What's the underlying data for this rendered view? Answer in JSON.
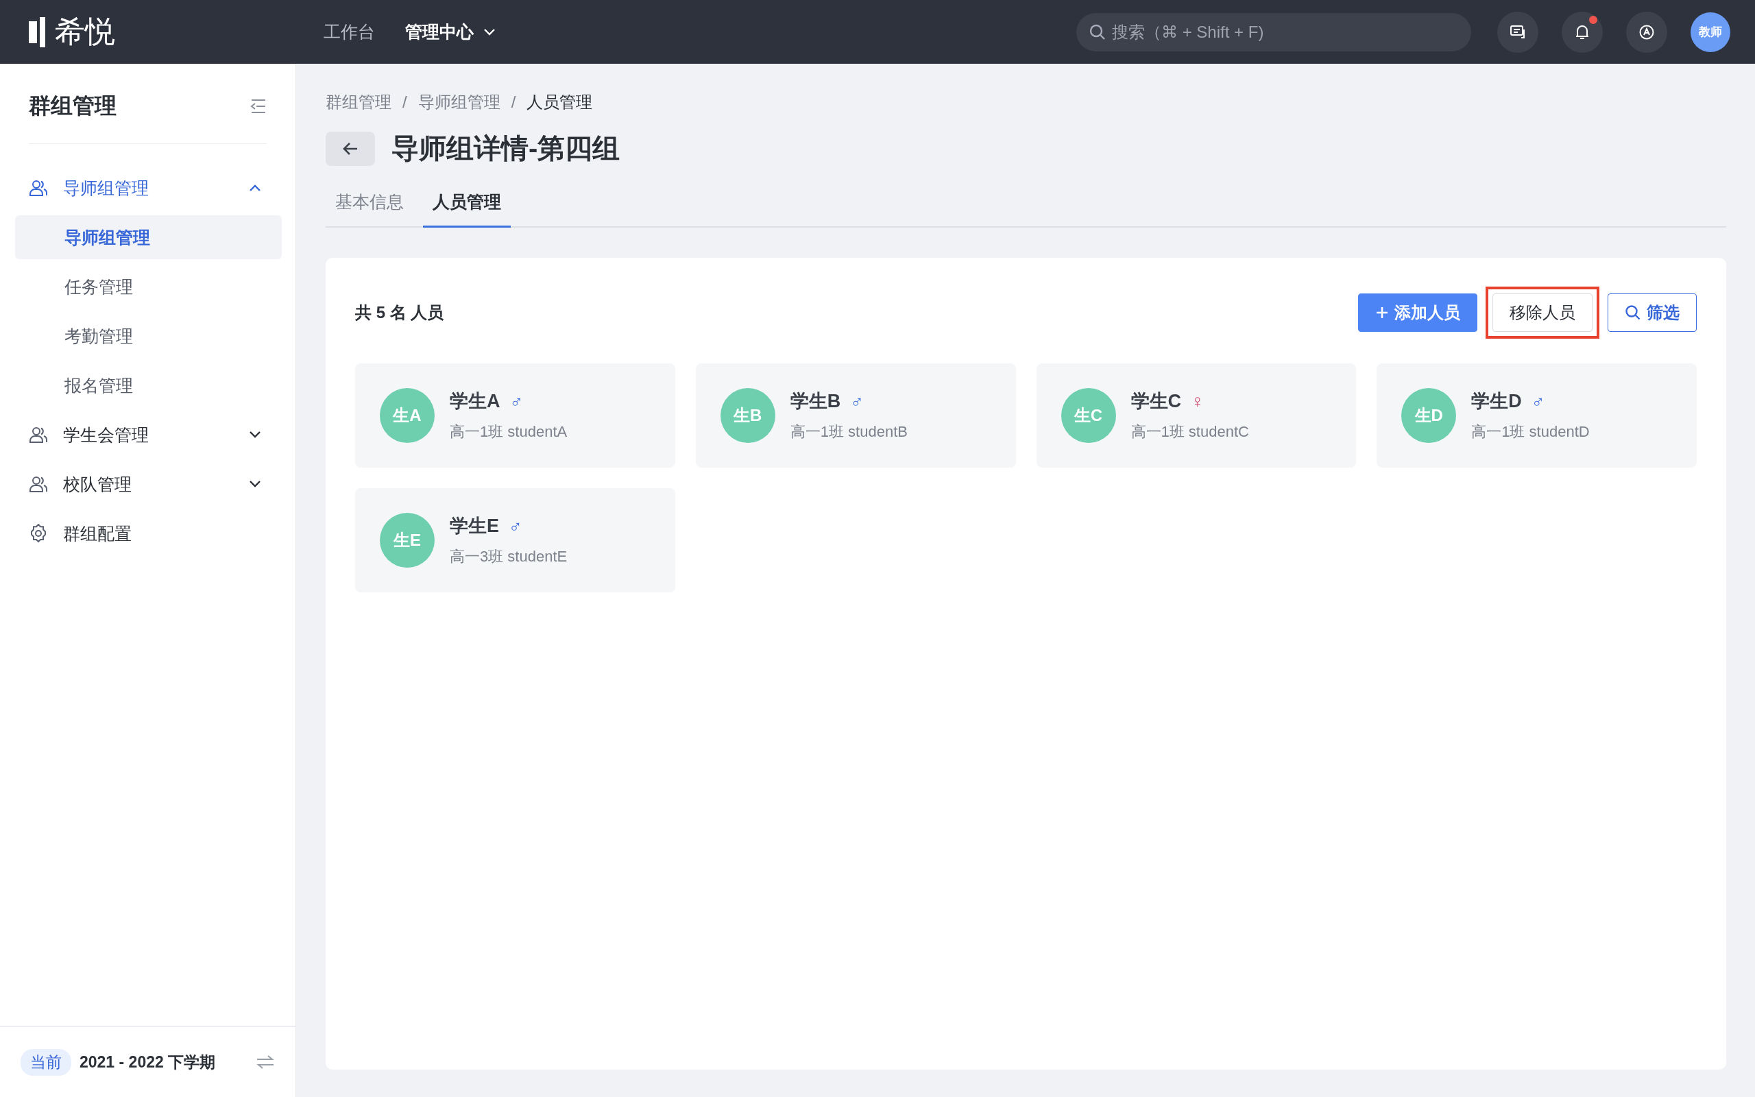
{
  "topbar": {
    "logo": "希悦",
    "nav": [
      {
        "label": "工作台",
        "selected": false,
        "dropdown": false
      },
      {
        "label": "管理中心",
        "selected": true,
        "dropdown": true
      }
    ],
    "search": {
      "placeholder": "搜索（⌘ + Shift + F)"
    },
    "icons": [
      {
        "kind": "chat",
        "badge": false
      },
      {
        "kind": "bell",
        "badge": true
      },
      {
        "kind": "switch",
        "badge": false
      }
    ],
    "avatar": "教师"
  },
  "sidebar": {
    "title": "群组管理",
    "items": [
      {
        "label": "导师组管理",
        "kind": "group",
        "selected": true,
        "expanded": true,
        "children": [
          {
            "label": "导师组管理",
            "selected": true
          },
          {
            "label": "任务管理",
            "selected": false
          },
          {
            "label": "考勤管理",
            "selected": false
          },
          {
            "label": "报名管理",
            "selected": false
          }
        ]
      },
      {
        "label": "学生会管理",
        "kind": "group",
        "selected": false,
        "expanded": false
      },
      {
        "label": "校队管理",
        "kind": "group",
        "selected": false,
        "expanded": false
      },
      {
        "label": "群组配置",
        "kind": "config",
        "selected": false
      }
    ],
    "footer": {
      "tag": "当前",
      "term": "2021 - 2022 下学期"
    }
  },
  "breadcrumb": [
    {
      "label": "群组管理"
    },
    {
      "separator": "/",
      "label": "导师组管理"
    },
    {
      "separator": "/",
      "label": "人员管理"
    }
  ],
  "page_title": "导师组详情-第四组",
  "tabs": [
    {
      "label": "基本信息",
      "selected": false
    },
    {
      "label": "人员管理",
      "selected": true
    }
  ],
  "panel": {
    "count": "共 5 名 人员",
    "buttons": [
      {
        "kind": "primary",
        "label": "添加人员",
        "highlighted": false
      },
      {
        "kind": "default",
        "label": "移除人员",
        "highlighted": true
      },
      {
        "kind": "outline",
        "label": "筛选",
        "highlighted": false
      }
    ],
    "members": [
      {
        "avatar": "生A",
        "name": "学生A",
        "kind": "male",
        "sign": "♂",
        "info": "高一1班 studentA"
      },
      {
        "avatar": "生B",
        "name": "学生B",
        "kind": "male",
        "sign": "♂",
        "info": "高一1班 studentB"
      },
      {
        "avatar": "生C",
        "name": "学生C",
        "kind": "female",
        "sign": "♀",
        "info": "高一1班 studentC"
      },
      {
        "avatar": "生D",
        "name": "学生D",
        "kind": "male",
        "sign": "♂",
        "info": "高一1班 studentD"
      },
      {
        "avatar": "生E",
        "name": "学生E",
        "kind": "male",
        "sign": "♂",
        "info": "高一3班 studentE"
      }
    ]
  }
}
